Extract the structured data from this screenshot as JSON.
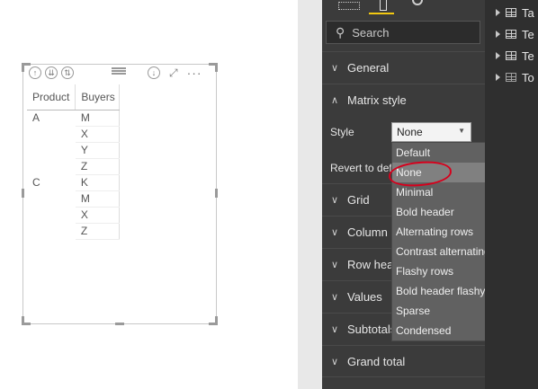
{
  "matrix": {
    "headers": [
      "Product",
      "Buyers"
    ],
    "rows": [
      {
        "product": "A",
        "buyer": "M"
      },
      {
        "product": "",
        "buyer": "X"
      },
      {
        "product": "",
        "buyer": "Y"
      },
      {
        "product": "",
        "buyer": "Z"
      },
      {
        "product": "C",
        "buyer": "K"
      },
      {
        "product": "",
        "buyer": "M"
      },
      {
        "product": "",
        "buyer": "X"
      },
      {
        "product": "",
        "buyer": "Z"
      }
    ]
  },
  "format_pane": {
    "search_placeholder": "Search",
    "sections": {
      "general": "General",
      "matrix_style": "Matrix style",
      "grid": "Grid",
      "column_headers": "Column h",
      "row_headers": "Row head",
      "values": "Values",
      "subtotals": "Subtotals",
      "grand_total": "Grand total"
    },
    "style_label": "Style",
    "style_value": "None",
    "revert_label": "Revert to def"
  },
  "style_options": [
    "Default",
    "None",
    "Minimal",
    "Bold header",
    "Alternating rows",
    "Contrast alternating rows",
    "Flashy rows",
    "Bold header flashy rows",
    "Sparse",
    "Condensed"
  ],
  "selected_style": "None",
  "fields": [
    "Ta",
    "Te",
    "Te",
    "To"
  ],
  "colors": {
    "accent": "#f2c811",
    "annotation": "#d6001c",
    "panel": "#3b3b3b"
  }
}
